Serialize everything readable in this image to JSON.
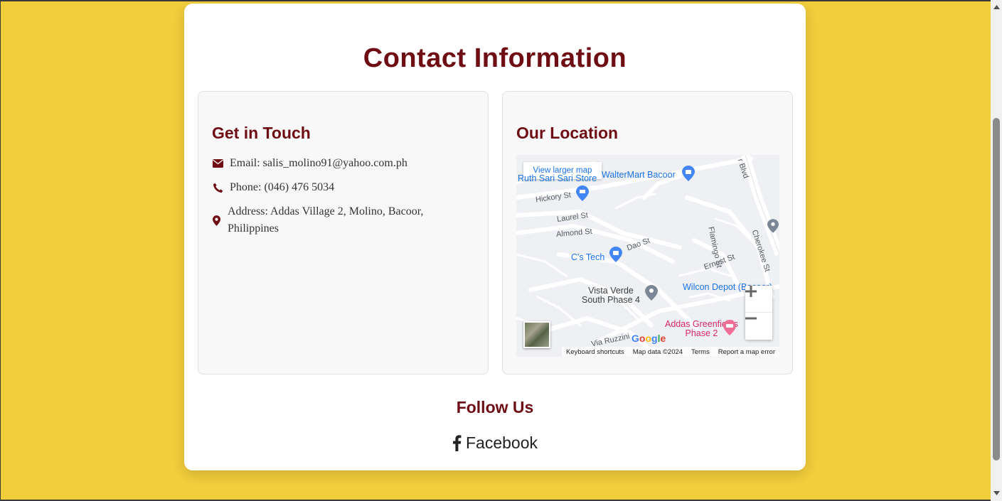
{
  "page": {
    "title": "Contact Information",
    "colors": {
      "background": "#f2cd3c",
      "accent": "#6e0d14",
      "card": "#ffffff"
    }
  },
  "get_in_touch": {
    "heading": "Get in Touch",
    "items": [
      {
        "icon": "envelope-icon",
        "text": "Email: salis_molino91@yahoo.com.ph"
      },
      {
        "icon": "phone-icon",
        "text": "Phone: (046) 476 5034"
      },
      {
        "icon": "map-pin-icon",
        "text": "Address: Addas Village 2, Molino, Bacoor, Philippines"
      }
    ]
  },
  "location": {
    "heading": "Our Location",
    "map": {
      "view_larger": "View larger map",
      "places": {
        "walter_mart": "WalterMart Bacoor",
        "ruth_store": "Ruth Sari Sari Store",
        "cs_tech": "C's Tech",
        "wilcon": "Wilcon Depot (Bacoor)",
        "vista_verde": "Vista Verde\nSouth Phase 4",
        "addas": "Addas Greenfields\nPhase 2"
      },
      "streets": {
        "hickory": "Hickory St",
        "laurel": "Laurel St",
        "almond": "Almond St",
        "dao": "Dao St",
        "flamingo": "Flamingo St",
        "cherokee": "Cherokee St",
        "ernest": "Ernest St",
        "via_ruzzini": "Via Ruzzini",
        "blvd": "r Blvd"
      },
      "google": "Google",
      "zoom_in": "+",
      "zoom_out": "−",
      "footer": {
        "shortcuts": "Keyboard shortcuts",
        "data": "Map data ©2024",
        "terms": "Terms",
        "report": "Report a map error"
      }
    }
  },
  "follow": {
    "heading": "Follow Us",
    "links": [
      {
        "icon": "facebook-icon",
        "label": "Facebook"
      }
    ]
  }
}
